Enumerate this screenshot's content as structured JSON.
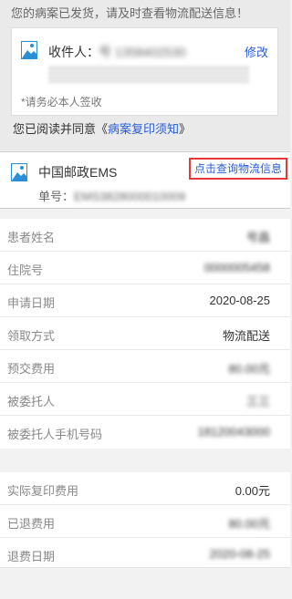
{
  "notice": "您的病案已发货，请及时查看物流配送信息！",
  "address_card": {
    "recipient_label": "收件人：",
    "recipient_value": "号   1358402530",
    "edit_label": "修改",
    "sign_note": "*请务必本人签收"
  },
  "agreement": {
    "prefix": "您已阅读并同意《",
    "link": "病案复印须知",
    "suffix": "》"
  },
  "shipping": {
    "carrier": "中国邮政EMS",
    "track_label": "点击查询物流信息",
    "tracking_label": "单号：",
    "tracking_value": "EMS3828000010009"
  },
  "details": [
    {
      "label": "患者姓名",
      "value": "号昌",
      "blurred": true
    },
    {
      "label": "住院号",
      "value": "0000005458",
      "blurred": true
    },
    {
      "label": "申请日期",
      "value": "2020-08-25",
      "blurred": false
    },
    {
      "label": "领取方式",
      "value": "物流配送",
      "blurred": false
    },
    {
      "label": "预交费用",
      "value": "80.00元",
      "blurred": true
    },
    {
      "label": "被委托人",
      "value": "三三",
      "blurred": true
    },
    {
      "label": "被委托人手机号码",
      "value": "18120043000",
      "blurred": true
    }
  ],
  "fees": [
    {
      "label": "实际复印费用",
      "value": "0.00元",
      "blurred": false
    },
    {
      "label": "已退费用",
      "value": "80.00元",
      "blurred": true
    },
    {
      "label": "退费日期",
      "value": "2020-08-25",
      "blurred": true
    }
  ],
  "colors": {
    "link": "#2a5cd6",
    "highlight_border": "#e53935"
  }
}
